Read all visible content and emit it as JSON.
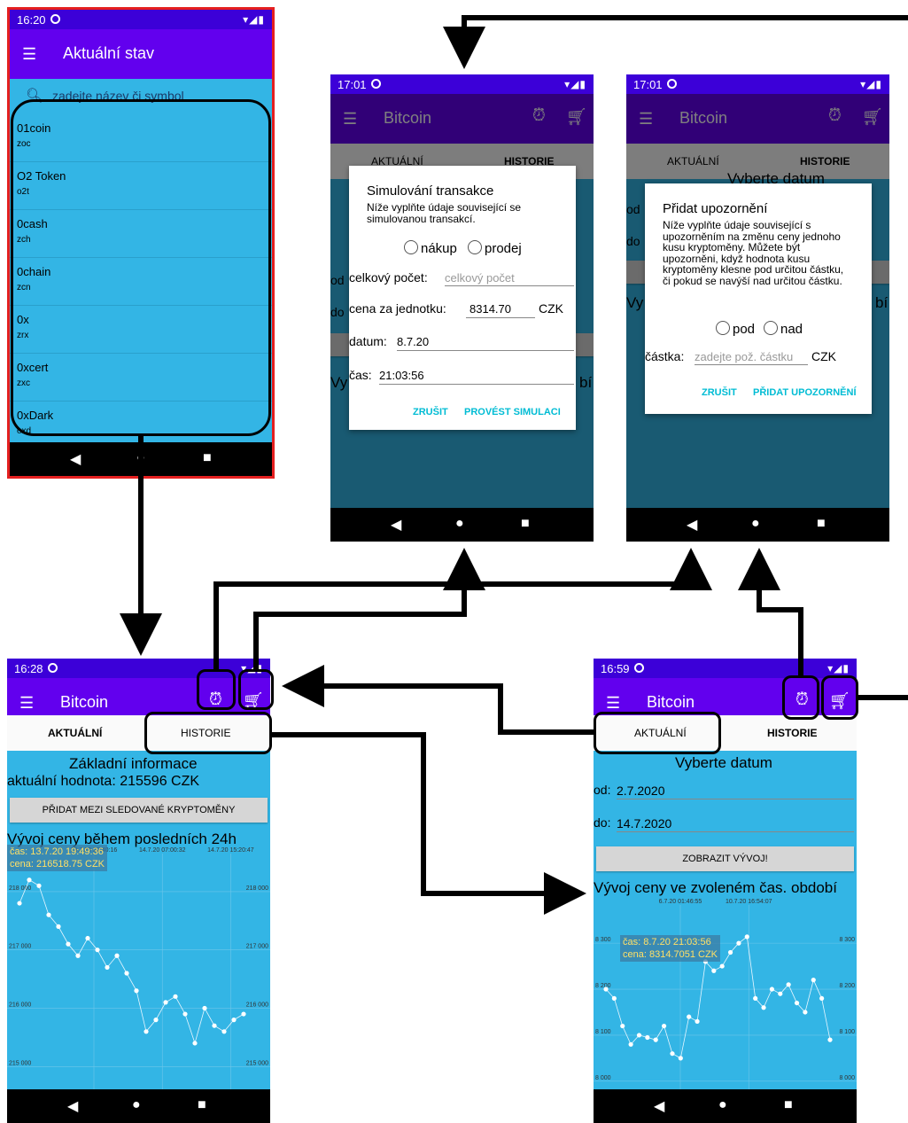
{
  "status": {
    "time1": "16:20",
    "time2": "17:01",
    "time3": "17:01",
    "time4": "16:28",
    "time5": "16:59"
  },
  "list_screen": {
    "title": "Aktuální stav",
    "search_placeholder": "zadejte název či symbol",
    "items": [
      {
        "name": "01coin",
        "symbol": "zoc"
      },
      {
        "name": "O2 Token",
        "symbol": "o2t"
      },
      {
        "name": "0cash",
        "symbol": "zch"
      },
      {
        "name": "0chain",
        "symbol": "zcn"
      },
      {
        "name": "0x",
        "symbol": "zrx"
      },
      {
        "name": "0xcert",
        "symbol": "zxc"
      },
      {
        "name": "0xDark",
        "symbol": "oxd"
      }
    ]
  },
  "coin": {
    "title": "Bitcoin"
  },
  "tabs": {
    "current": "AKTUÁLNÍ",
    "history": "HISTORIE"
  },
  "simulate_dialog": {
    "title": "Simulování transakce",
    "desc": "Níže vyplňte údaje související se simulovanou transakcí.",
    "buy": "nákup",
    "sell": "prodej",
    "count_label": "celkový počet:",
    "count_placeholder": "celkový počet",
    "price_label": "cena za jednotku:",
    "price_value": "8314.70",
    "currency": "CZK",
    "date_label": "datum:",
    "date_value": "8.7.20",
    "time_label": "čas:",
    "time_value": "21:03:56",
    "cancel": "ZRUŠIT",
    "confirm": "PROVÉST SIMULACI"
  },
  "alert_dialog": {
    "title": "Přidat upozornění",
    "desc": "Níže vyplňte údaje související s upozorněním na změnu ceny jednoho kusu kryptoměny. Můžete být upozorněni, když hodnota kusu kryptoměny klesne pod určitou částku, či pokud se navýší nad určitou částku.",
    "under": "pod",
    "over": "nad",
    "amount_label": "částka:",
    "amount_placeholder": "zadejte pož. částku",
    "currency": "CZK",
    "cancel": "ZRUŠIT",
    "confirm": "PŘIDAT UPOZORNĚNÍ"
  },
  "bg_history": {
    "select_date": "Vyberte datum",
    "od": "od",
    "do": "do",
    "vy": "Vy",
    "obdi": "bí"
  },
  "current_screen": {
    "heading": "Základní informace",
    "value": "aktuální hodnota: 215596 CZK",
    "track_button": "PŘIDAT MEZI SLEDOVANÉ KRYPTOMĚNY",
    "chart_title": "Vývoj ceny během posledních 24h",
    "tooltip_time": "čas: 13.7.20 19:49:36",
    "tooltip_price": "cena: 216518.75 CZK"
  },
  "history_screen": {
    "select_date": "Vyberte datum",
    "od_label": "od:",
    "od_value": "2.7.2020",
    "do_label": "do:",
    "do_value": "14.7.2020",
    "show_button": "ZOBRAZIT VÝVOJ!",
    "chart_title": "Vývoj ceny ve zvoleném čas. období",
    "tooltip_time": "čas: 8.7.20 21:03:56",
    "tooltip_price": "cena: 8314.7051 CZK"
  },
  "chart_data": [
    {
      "type": "scatter",
      "title": "Vývoj ceny během posledních 24h",
      "x_tick_labels": [
        "13.7.20 22:40:16",
        "14.7.20 07:00:32",
        "14.7.20 15:20:47"
      ],
      "y_ticks": [
        215000,
        216000,
        217000,
        218000
      ],
      "ylim": [
        214700,
        218500
      ],
      "values": [
        217800,
        218200,
        218100,
        217600,
        217400,
        217100,
        216900,
        217200,
        217000,
        216700,
        216900,
        216600,
        216300,
        215600,
        215800,
        216100,
        216200,
        215900,
        215400,
        216000,
        215700,
        215600,
        215800,
        215900
      ]
    },
    {
      "type": "scatter",
      "title": "Vývoj ceny ve zvoleném čas. období",
      "x_tick_labels": [
        "6.7.20 01:46:55",
        "10.7.20 16:54:07"
      ],
      "y_ticks": [
        8000,
        8100,
        8200,
        8300
      ],
      "ylim": [
        7990,
        8360
      ],
      "values": [
        8200,
        8180,
        8120,
        8080,
        8100,
        8095,
        8090,
        8120,
        8060,
        8050,
        8140,
        8130,
        8260,
        8240,
        8250,
        8280,
        8300,
        8314,
        8180,
        8160,
        8200,
        8190,
        8210,
        8170,
        8150,
        8220,
        8180,
        8090
      ]
    }
  ]
}
